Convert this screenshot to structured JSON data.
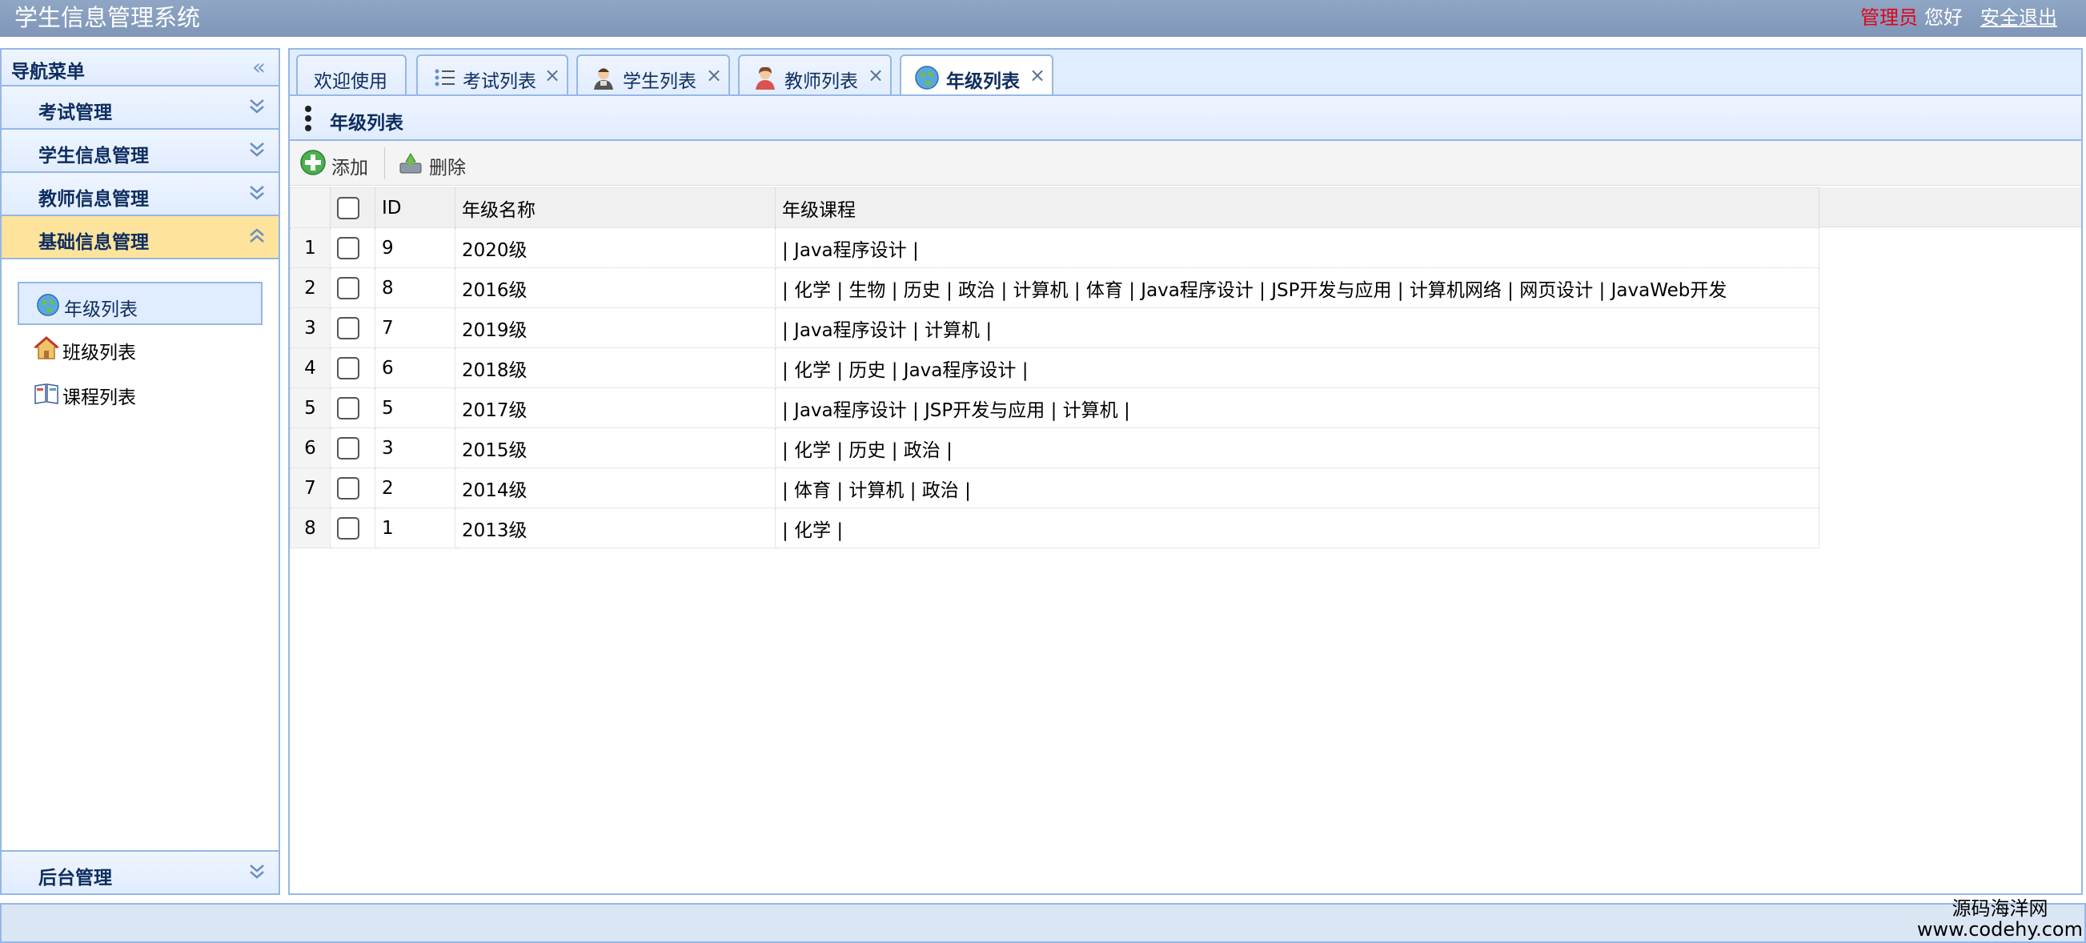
{
  "header": {
    "title": "学生信息管理系统",
    "admin": "管理员",
    "hello": "您好",
    "logout": "安全退出"
  },
  "sidebar": {
    "title": "导航菜单",
    "groups": [
      {
        "label": "考试管理"
      },
      {
        "label": "学生信息管理"
      },
      {
        "label": "教师信息管理"
      },
      {
        "label": "基础信息管理"
      }
    ],
    "items": [
      {
        "label": "年级列表",
        "icon": "globe-icon"
      },
      {
        "label": "班级列表",
        "icon": "house-icon"
      },
      {
        "label": "课程列表",
        "icon": "book-icon"
      }
    ],
    "bottom_group": "后台管理"
  },
  "tabs": [
    {
      "label": "欢迎使用"
    },
    {
      "label": "考试列表",
      "icon": "list-icon"
    },
    {
      "label": "学生列表",
      "icon": "student-icon"
    },
    {
      "label": "教师列表",
      "icon": "teacher-icon"
    },
    {
      "label": "年级列表",
      "icon": "globe-icon"
    }
  ],
  "panel": {
    "title": "年级列表",
    "toolbar": {
      "add": "添加",
      "delete": "删除"
    }
  },
  "grid": {
    "columns": {
      "id": "ID",
      "name": "年级名称",
      "courses": "年级课程"
    },
    "rows": [
      {
        "num": "1",
        "id": "9",
        "name": "2020级",
        "courses": "| Java程序设计 |"
      },
      {
        "num": "2",
        "id": "8",
        "name": "2016级",
        "courses": "| 化学 | 生物 | 历史 | 政治 | 计算机 | 体育 | Java程序设计 | JSP开发与应用 | 计算机网络 | 网页设计 | JavaWeb开发"
      },
      {
        "num": "3",
        "id": "7",
        "name": "2019级",
        "courses": "| Java程序设计 | 计算机 |"
      },
      {
        "num": "4",
        "id": "6",
        "name": "2018级",
        "courses": "| 化学 | 历史 | Java程序设计 |"
      },
      {
        "num": "5",
        "id": "5",
        "name": "2017级",
        "courses": "| Java程序设计 | JSP开发与应用 | 计算机 |"
      },
      {
        "num": "6",
        "id": "3",
        "name": "2015级",
        "courses": "| 化学 | 历史 | 政治 |"
      },
      {
        "num": "7",
        "id": "2",
        "name": "2014级",
        "courses": "| 体育 | 计算机 | 政治 |"
      },
      {
        "num": "8",
        "id": "1",
        "name": "2013级",
        "courses": "| 化学 |"
      }
    ]
  },
  "watermark": {
    "line1": "源码海洋网",
    "line2": "www.codehy.com"
  },
  "colors": {
    "accent": "#95b8e7",
    "header": "#8fa6c4",
    "active_group": "#fde39b",
    "admin": "#e3001b"
  }
}
